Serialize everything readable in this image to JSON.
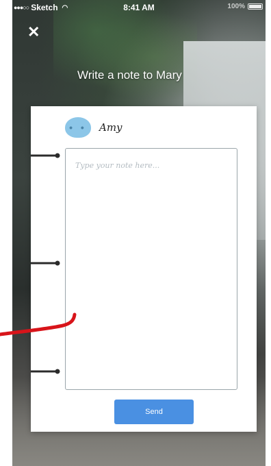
{
  "status_bar": {
    "carrier": "Sketch",
    "time": "8:41 AM",
    "battery": "100%"
  },
  "header": {
    "close_icon": "close-icon",
    "title": "Write a note to Mary"
  },
  "card": {
    "recipient": {
      "avatar_icon": "elephant-avatar",
      "avatar_glyph": "• •",
      "name": "Amy"
    },
    "note": {
      "value": "",
      "placeholder": "Type your note here..."
    },
    "send_label": "Send"
  },
  "colors": {
    "accent": "#4A90E2",
    "avatar": "#8CC6E8",
    "annotation_red": "#D8141A",
    "annotation_line": "#2B2B2B"
  }
}
